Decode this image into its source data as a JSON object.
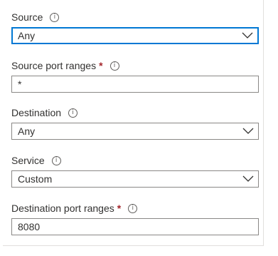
{
  "fields": [
    {
      "label": "Source",
      "required": false,
      "type": "dropdown",
      "value": "Any",
      "focused": true
    },
    {
      "label": "Source port ranges",
      "required": true,
      "type": "text",
      "value": "*"
    },
    {
      "label": "Destination",
      "required": false,
      "type": "dropdown",
      "value": "Any"
    },
    {
      "label": "Service",
      "required": false,
      "type": "dropdown",
      "value": "Custom"
    },
    {
      "label": "Destination port ranges",
      "required": true,
      "type": "text",
      "value": "8080"
    }
  ],
  "required_marker": "*",
  "info_glyph": "i",
  "icons": {
    "info": "info-icon",
    "dropdown": "chevron-down-icon"
  },
  "colors": {
    "focus_border": "#0078d4",
    "required": "#a4262c",
    "border": "#8a8886",
    "text": "#323130"
  }
}
